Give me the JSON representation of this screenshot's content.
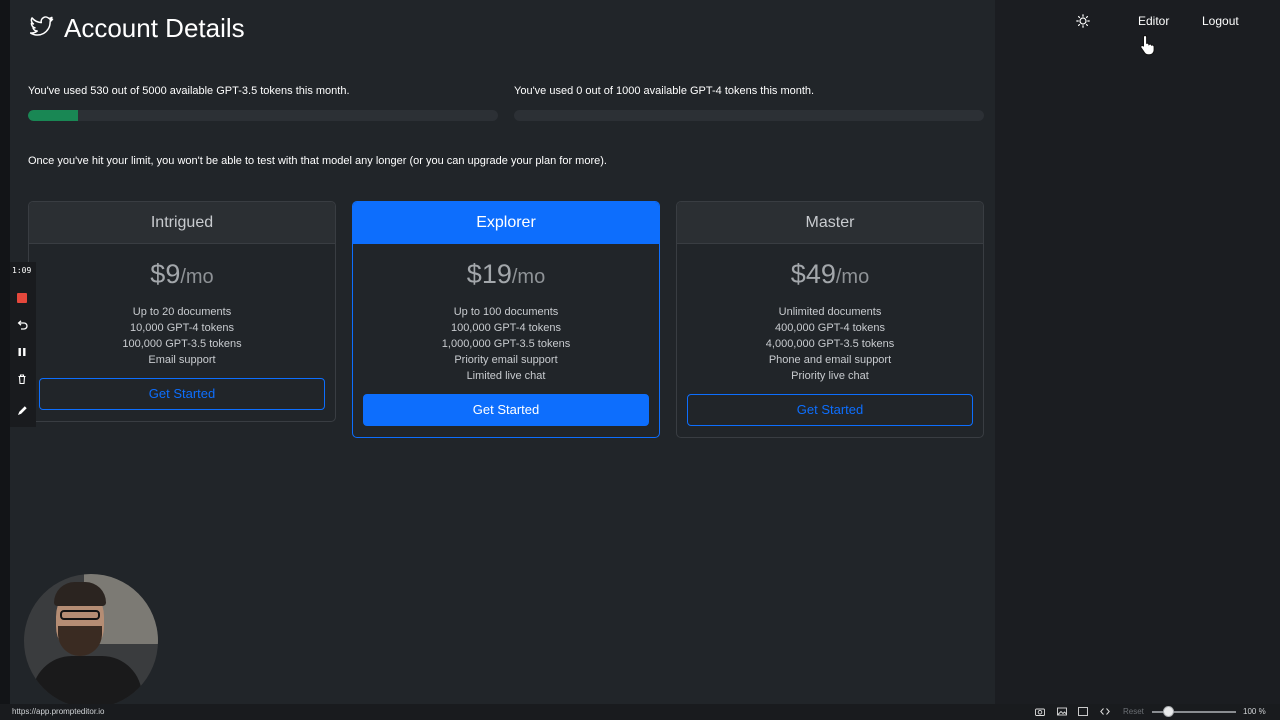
{
  "header": {
    "title": "Account Details",
    "logo_icon": "bird-icon",
    "theme_icon": "sun-icon",
    "nav": {
      "editor": "Editor",
      "logout": "Logout"
    }
  },
  "usage": {
    "gpt35_text": "You've used 530 out of 5000 available GPT-3.5 tokens this month.",
    "gpt35_used": 530,
    "gpt35_total": 5000,
    "gpt4_text": "You've used 0 out of 1000 available GPT-4 tokens this month.",
    "gpt4_used": 0,
    "gpt4_total": 1000,
    "note": "Once you've hit your limit, you won't be able to test with that model any longer (or you can upgrade your plan for more).",
    "bar_color": "#198754"
  },
  "plans": [
    {
      "name": "Intrigued",
      "price": "$9",
      "period": "/mo",
      "features": [
        "Up to 20 documents",
        "10,000 GPT-4 tokens",
        "100,000 GPT-3.5 tokens",
        "Email support"
      ],
      "cta": "Get Started"
    },
    {
      "name": "Explorer",
      "price": "$19",
      "period": "/mo",
      "features": [
        "Up to 100 documents",
        "100,000 GPT-4 tokens",
        "1,000,000 GPT-3.5 tokens",
        "Priority email support",
        "Limited live chat"
      ],
      "cta": "Get Started",
      "highlighted": true
    },
    {
      "name": "Master",
      "price": "$49",
      "period": "/mo",
      "features": [
        "Unlimited documents",
        "400,000 GPT-4 tokens",
        "4,000,000 GPT-3.5 tokens",
        "Phone and email support",
        "Priority live chat"
      ],
      "cta": "Get Started"
    }
  ],
  "accent_color": "#0d6efd",
  "recorder": {
    "time": "1:09",
    "icons": [
      "stop-icon",
      "undo-icon",
      "pause-icon",
      "trash-icon",
      "pen-icon"
    ]
  },
  "status_bar": {
    "url": "https://app.prompteditor.io",
    "reset": "Reset",
    "zoom": "100 %",
    "icons": [
      "camera-icon",
      "image-icon",
      "frame-icon",
      "code-icon"
    ]
  }
}
